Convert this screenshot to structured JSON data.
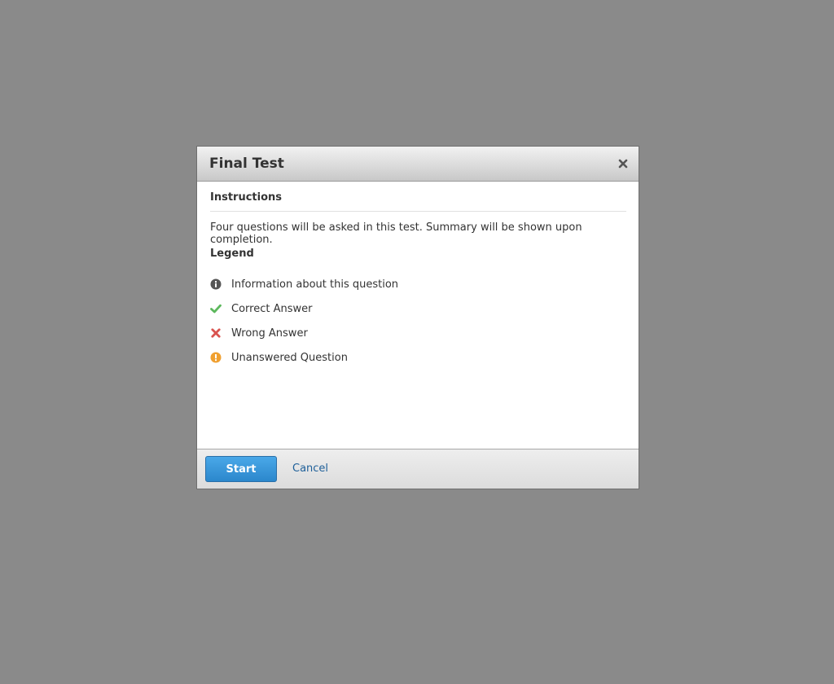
{
  "dialog": {
    "title": "Final Test",
    "close_icon": "close-icon"
  },
  "instructions": {
    "heading": "Instructions",
    "text": "Four questions will be asked in this test. Summary will be shown upon completion."
  },
  "legend": {
    "heading": "Legend",
    "items": [
      {
        "icon": "info-icon",
        "color": "#555555",
        "label": "Information about this question"
      },
      {
        "icon": "check-icon",
        "color": "#5cb85c",
        "label": "Correct Answer"
      },
      {
        "icon": "cross-icon",
        "color": "#d9534f",
        "label": "Wrong Answer"
      },
      {
        "icon": "exclamation-icon",
        "color": "#f0a030",
        "label": "Unanswered Question"
      }
    ]
  },
  "footer": {
    "start_label": "Start",
    "cancel_label": "Cancel"
  },
  "colors": {
    "overlay": "#8a8a8a",
    "primary_button": "#2b87cc",
    "link": "#1e5f99"
  }
}
